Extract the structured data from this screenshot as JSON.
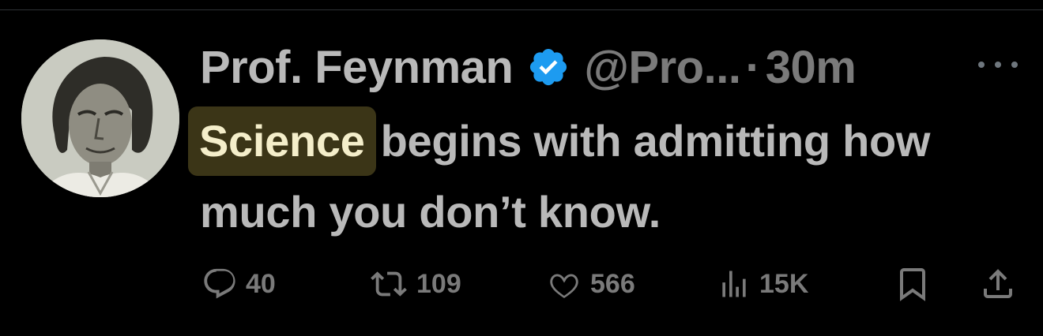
{
  "tweet": {
    "display_name": "Prof. Feynman",
    "handle": "@Pro...",
    "separator": "·",
    "time": "30m",
    "text_highlight": "Science",
    "text_rest": "begins with admitting how much you don’t know.",
    "verified_color": "#1d9bf0"
  },
  "actions": {
    "replies": "40",
    "reposts": "109",
    "likes": "566",
    "views": "15K"
  },
  "icons": {
    "verified": "verified-badge-icon",
    "more": "more-horizontal-icon",
    "reply": "reply-icon",
    "repost": "repost-icon",
    "like": "heart-icon",
    "views": "views-icon",
    "bookmark": "bookmark-icon",
    "share": "share-icon"
  },
  "colors": {
    "background": "#000000",
    "highlight_bg": "#3b3517",
    "highlight_text": "#f4eeca",
    "muted": "#7a7a7a"
  }
}
